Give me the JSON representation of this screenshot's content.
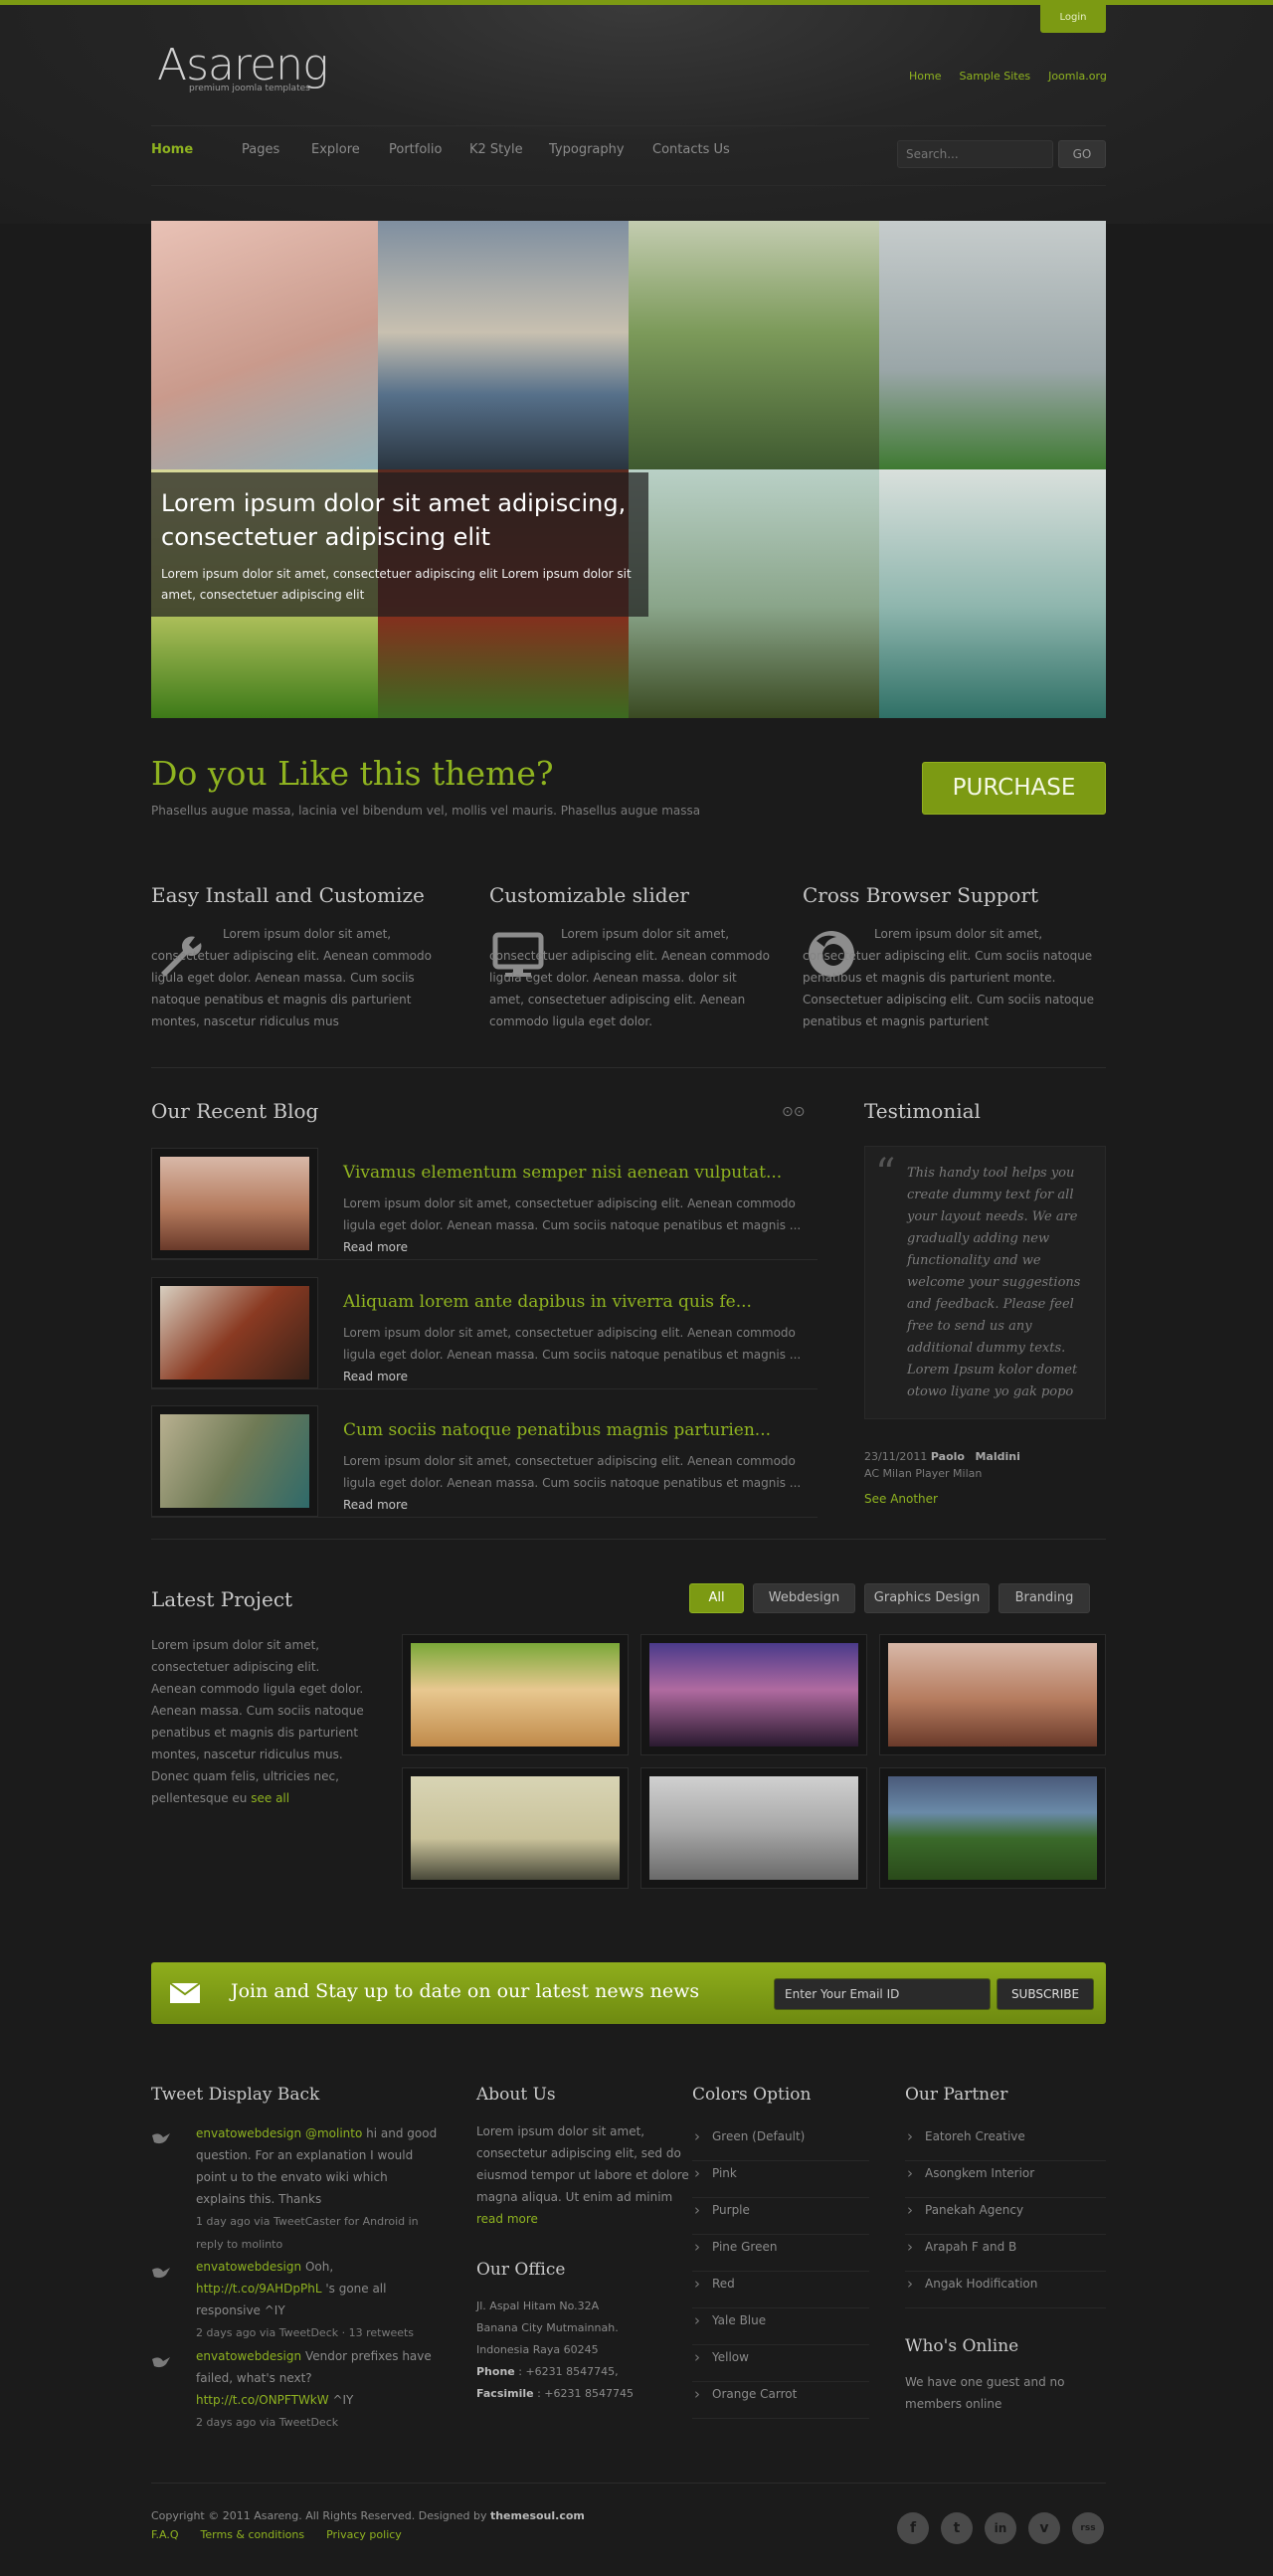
{
  "header": {
    "login": "Login",
    "logo": "Asareng",
    "tagline": "premium joomla templates",
    "top_links": [
      "Home",
      "Sample Sites",
      "Joomla.org"
    ]
  },
  "nav": {
    "items": [
      "Home",
      "Pages",
      "Explore",
      "Portfolio",
      "K2 Style",
      "Typography",
      "Contacts Us"
    ],
    "search_placeholder": "Search...",
    "go": "GO"
  },
  "slider": {
    "title": "Lorem ipsum dolor sit amet adipiscing, consectetuer adipiscing elit",
    "text": "Lorem ipsum dolor sit amet, consectetuer adipiscing elit Lorem ipsum dolor sit amet, consectetuer adipiscing elit"
  },
  "promo": {
    "title": "Do you Like this theme?",
    "subtitle": "Phasellus augue massa, lacinia vel bibendum vel, mollis vel mauris. Phasellus augue massa",
    "button": "PURCHASE"
  },
  "features": [
    {
      "title": "Easy Install and Customize",
      "icon": "wrench-icon",
      "text": "Lorem ipsum dolor sit amet, consectetuer adipiscing elit. Aenean commodo ligula eget dolor. Aenean massa. Cum sociis natoque penatibus et magnis dis parturient montes, nascetur ridiculus mus"
    },
    {
      "title": "Customizable slider",
      "icon": "monitor-icon",
      "text": "Lorem ipsum dolor sit amet, consectetuer adipiscing elit. Aenean commodo ligula eget dolor. Aenean massa. dolor sit amet, consectetuer adipiscing elit. Aenean commodo ligula eget dolor."
    },
    {
      "title": "Cross Browser Support",
      "icon": "firefox-icon",
      "text": "Lorem ipsum dolor sit amet, consectetuer adipiscing elit. Cum sociis natoque penatibus et magnis dis parturient monte. Consectetuer adipiscing elit. Cum sociis natoque penatibus et magnis parturient"
    }
  ],
  "blog": {
    "title": "Our Recent Blog",
    "read_more": "Read more",
    "posts": [
      {
        "title": "Vivamus elementum semper nisi aenean vulputat...",
        "text": "Lorem ipsum dolor sit amet, consectetuer adipiscing elit. Aenean commodo ligula eget dolor. Aenean massa. Cum sociis natoque penatibus et magnis ..."
      },
      {
        "title": "Aliquam lorem ante dapibus in viverra quis fe...",
        "text": "Lorem ipsum dolor sit amet, consectetuer adipiscing elit. Aenean commodo ligula eget dolor. Aenean massa. Cum sociis natoque penatibus et magnis ..."
      },
      {
        "title": "Cum sociis natoque penatibus magnis parturien...",
        "text": "Lorem ipsum dolor sit amet, consectetuer adipiscing elit. Aenean commodo ligula eget dolor. Aenean massa. Cum sociis natoque penatibus et magnis ..."
      }
    ]
  },
  "testimonial": {
    "title": "Testimonial",
    "text": "This handy tool helps you create dummy text for all your layout needs. We are gradually adding new functionality and we welcome your suggestions and feedback. Please feel free to send us any additional dummy texts. Lorem Ipsum kolor domet otowo liyane yo gak popo",
    "date": "23/11/2011",
    "author_first": "Paolo",
    "author_last": "Maldini",
    "role": "AC Milan Player Milan",
    "see_another": "See Another"
  },
  "projects": {
    "title": "Latest Project",
    "filters": [
      "All",
      "Webdesign",
      "Graphics Design",
      "Branding"
    ],
    "text": "Lorem ipsum dolor sit amet, consectetuer adipiscing elit. Aenean commodo ligula eget dolor. Aenean massa. Cum sociis natoque penatibus et magnis dis parturient montes, nascetur ridiculus mus. Donec quam felis, ultricies nec, pellentesque eu",
    "see_all": "see all"
  },
  "newsletter": {
    "text": "Join and Stay up to date on our latest news news",
    "placeholder": "Enter Your Email ID",
    "button": "SUBSCRIBE"
  },
  "footer": {
    "tweets_title": "Tweet Display Back",
    "tweets": [
      {
        "user": "envatowebdesign",
        "mention": "@molinto",
        "text": " hi and good question. For an explanation I would point u to the envato wiki which explains this. Thanks",
        "meta": "1 day ago via TweetCaster for Android in reply to molinto"
      },
      {
        "user": "envatowebdesign",
        "mention": " Ooh, ",
        "link": "http://t.co/9AHDpPhL",
        "text": " 's gone all responsive ^IY",
        "meta": "2 days ago via TweetDeck · 13 retweets"
      },
      {
        "user": "envatowebdesign",
        "text": " Vendor prefixes have failed, what's next? ",
        "link": "http://t.co/ONPFTWkW",
        "text2": " ^IY",
        "meta": "2 days ago via TweetDeck"
      }
    ],
    "about_title": "About Us",
    "about_text": "Lorem ipsum dolor sit amet, consectetur adipiscing elit, sed do eiusmod tempor ut labore et dolore magna aliqua. Ut enim ad minim",
    "read_more": "read more",
    "office_title": "Our Office",
    "address1": "Jl. Aspal Hitam No.32A",
    "address2": "Banana City Mutmainnah.",
    "address3": "Indonesia Raya 60245",
    "phone_label": "Phone",
    "phone": " : +6231 8547745,",
    "fax_label": "Facsimile",
    "fax": " : +6231 8547745",
    "colors_title": "Colors Option",
    "colors": [
      "Green (Default)",
      "Pink",
      "Purple",
      "Pine Green",
      "Red",
      "Yale Blue",
      "Yellow",
      "Orange Carrot"
    ],
    "partner_title": "Our Partner",
    "partners": [
      "Eatoreh Creative",
      "Asongkem Interior",
      "Panekah Agency",
      "Arapah F and B",
      "Angak Hodification"
    ],
    "online_title": "Who's Online",
    "online_text": "We have one guest and no members online",
    "copyright": "Copyright © 2011 Asareng. All Rights Reserved. Designed by ",
    "designer": "themesoul.com",
    "links": [
      "F.A.Q",
      "Terms & conditions",
      "Privacy policy"
    ],
    "social": [
      "f",
      "t",
      "in",
      "v",
      "rss"
    ]
  }
}
